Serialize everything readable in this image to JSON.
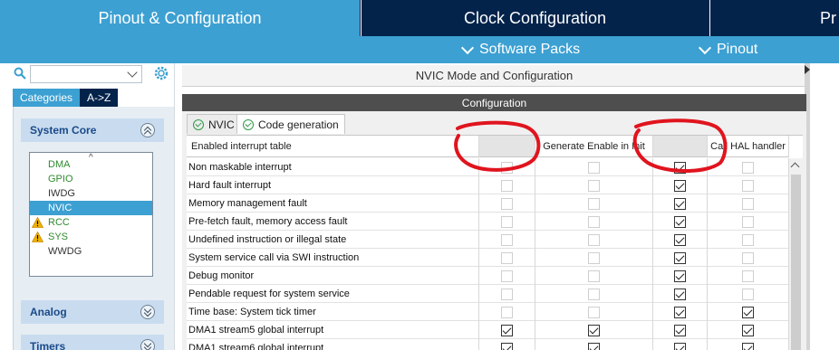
{
  "tabs": {
    "pinout_config": "Pinout & Configuration",
    "clock_config": "Clock Configuration",
    "project_partial": "Pr"
  },
  "subbar": {
    "software_packs": "Software Packs",
    "pinout": "Pinout"
  },
  "left": {
    "search_value": "",
    "categories_tab": "Categories",
    "az_tab": "A->Z",
    "system_core": "System Core",
    "analog": "Analog",
    "timers": "Timers",
    "peripherals": [
      {
        "label": "DMA",
        "state": "green"
      },
      {
        "label": "GPIO",
        "state": "green"
      },
      {
        "label": "IWDG",
        "state": "gray"
      },
      {
        "label": "NVIC",
        "state": "selected"
      },
      {
        "label": "RCC",
        "state": "warn"
      },
      {
        "label": "SYS",
        "state": "warn"
      },
      {
        "label": "WWDG",
        "state": "gray"
      }
    ]
  },
  "main": {
    "mode_header": "NVIC Mode and Configuration",
    "config_title": "Configuration",
    "tab_nvic": "NVIC",
    "tab_codegen": "Code generation",
    "table": {
      "headers": [
        "Enabled interrupt table",
        "",
        "Generate Enable in Init",
        "",
        "Call HAL handler"
      ],
      "rows": [
        {
          "name": "Non maskable interrupt",
          "c1": "disabled",
          "c2": "disabled",
          "c3": "on",
          "c4": "disabled"
        },
        {
          "name": "Hard fault interrupt",
          "c1": "disabled",
          "c2": "disabled",
          "c3": "on",
          "c4": "disabled"
        },
        {
          "name": "Memory management fault",
          "c1": "disabled",
          "c2": "disabled",
          "c3": "on",
          "c4": "disabled"
        },
        {
          "name": "Pre-fetch fault, memory access fault",
          "c1": "disabled",
          "c2": "disabled",
          "c3": "on",
          "c4": "disabled"
        },
        {
          "name": "Undefined instruction or illegal state",
          "c1": "disabled",
          "c2": "disabled",
          "c3": "on",
          "c4": "disabled"
        },
        {
          "name": "System service call via SWI instruction",
          "c1": "disabled",
          "c2": "disabled",
          "c3": "on",
          "c4": "disabled"
        },
        {
          "name": "Debug monitor",
          "c1": "disabled",
          "c2": "disabled",
          "c3": "on",
          "c4": "disabled"
        },
        {
          "name": "Pendable request for system service",
          "c1": "disabled",
          "c2": "disabled",
          "c3": "on",
          "c4": "disabled"
        },
        {
          "name": "Time base: System tick timer",
          "c1": "disabled",
          "c2": "disabled",
          "c3": "on",
          "c4": "on"
        },
        {
          "name": "DMA1 stream5 global interrupt",
          "c1": "on",
          "c2": "on",
          "c3": "on",
          "c4": "on"
        },
        {
          "name": "DMA1 stream6 global interrupt",
          "c1": "on",
          "c2": "on",
          "c3": "on",
          "c4": "on"
        }
      ]
    }
  },
  "colors": {
    "accent_blue": "#3ca0d2",
    "navy": "#03234b",
    "annotation_red": "#e0141e"
  }
}
